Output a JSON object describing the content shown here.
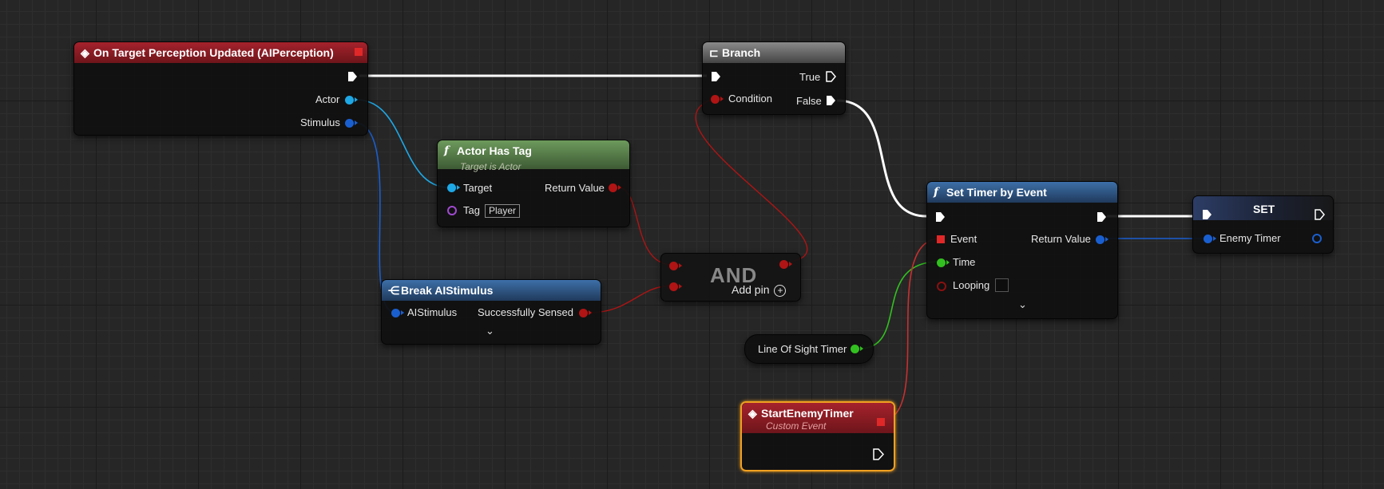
{
  "event_node": {
    "title": "On Target Perception Updated (AIPerception)",
    "pin_actor": "Actor",
    "pin_stimulus": "Stimulus"
  },
  "branch_node": {
    "title": "Branch",
    "pin_true": "True",
    "pin_condition": "Condition",
    "pin_false": "False"
  },
  "has_tag_node": {
    "title": "Actor Has Tag",
    "subtitle": "Target is Actor",
    "pin_target": "Target",
    "pin_return": "Return Value",
    "pin_tag": "Tag",
    "tag_value": "Player"
  },
  "and_node": {
    "title": "AND",
    "add_pin": "Add pin"
  },
  "break_node": {
    "title": "Break AIStimulus",
    "pin_in": "AIStimulus",
    "pin_out": "Successfully Sensed"
  },
  "timer_node": {
    "title": "Set Timer by Event",
    "pin_event": "Event",
    "pin_return": "Return Value",
    "pin_time": "Time",
    "pin_looping": "Looping"
  },
  "set_node": {
    "title": "SET",
    "pin_var": "Enemy Timer"
  },
  "var_node": {
    "label": "Line Of Sight Timer"
  },
  "custom_event_node": {
    "title": "StartEnemyTimer",
    "subtitle": "Custom Event"
  },
  "colors": {
    "exec": "#ffffff",
    "object": "#1ea8e6",
    "struct": "#1a5fd0",
    "bool": "#b01414",
    "float": "#32c020",
    "name": "#a04ad0",
    "selection": "#f0a020"
  }
}
